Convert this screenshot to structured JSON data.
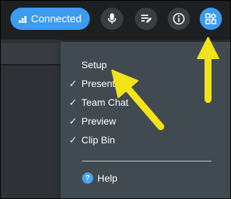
{
  "toolbar": {
    "connected_label": "Connected",
    "buttons": [
      {
        "name": "microphone-icon"
      },
      {
        "name": "notes-icon"
      },
      {
        "name": "info-icon"
      },
      {
        "name": "apps-icon"
      }
    ]
  },
  "menu": {
    "items": [
      {
        "label": "Setup",
        "checked": false
      },
      {
        "label": "Presenter",
        "checked": true
      },
      {
        "label": "Team Chat",
        "checked": true
      },
      {
        "label": "Preview",
        "checked": true
      },
      {
        "label": "Clip Bin",
        "checked": true
      }
    ],
    "help_label": "Help",
    "help_glyph": "?"
  },
  "colors": {
    "accent": "#3d9bf0",
    "menu_bg": "#424a51",
    "arrow": "#f2e31a"
  }
}
